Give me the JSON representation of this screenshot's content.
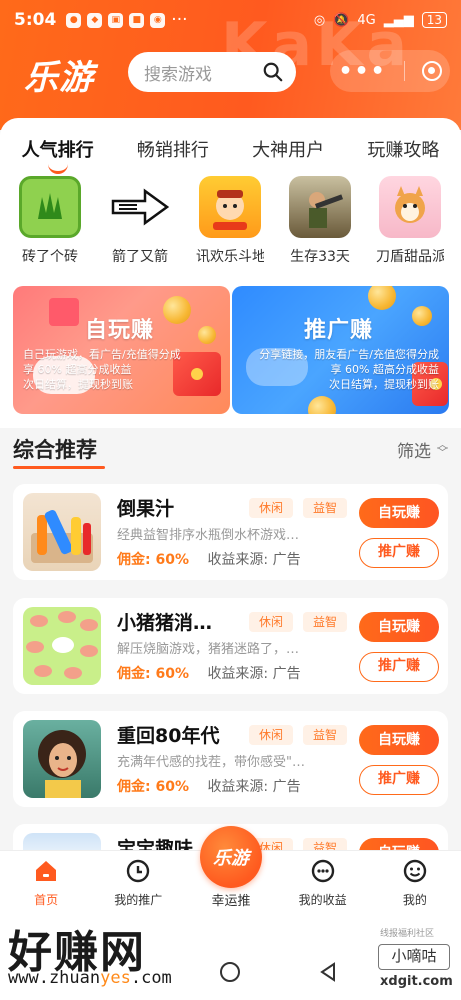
{
  "status_bar": {
    "time": "5:04",
    "more": "···",
    "battery": "13",
    "network": "4G"
  },
  "header": {
    "logo": "乐游",
    "search_placeholder": "搜索游戏",
    "watermark": "KaKa"
  },
  "tabs": [
    {
      "label": "人气排行",
      "active": true
    },
    {
      "label": "畅销排行",
      "active": false
    },
    {
      "label": "大神用户",
      "active": false
    },
    {
      "label": "玩赚攻略",
      "active": false
    }
  ],
  "games": [
    {
      "name": "砖了个砖",
      "icon": "grass-tile-icon",
      "bg": "#8fd14f"
    },
    {
      "name": "箭了又箭",
      "icon": "arrow-maze-icon",
      "bg": "#ffffff"
    },
    {
      "name": "讯欢乐斗地主",
      "icon": "landlord-character-icon",
      "bg": "#ffb21a"
    },
    {
      "name": "生存33天",
      "icon": "soldier-icon",
      "bg": "#8a7a5a"
    },
    {
      "name": "刀盾甜品派",
      "icon": "shiba-dog-icon",
      "bg": "#f7c8d0"
    }
  ],
  "banners": {
    "left": {
      "title": "自玩赚",
      "lines": [
        "自己玩游戏，看广告/充值得分成",
        "享 60% 超高分成收益",
        "次日结算，提现秒到账"
      ],
      "color": "#ff8a7a"
    },
    "right": {
      "title": "推广赚",
      "lines": [
        "分享链接，朋友看广告/充值您得分成",
        "享 60% 超高分成收益",
        "次日结算，提现秒到账"
      ],
      "color": "#2f8bff"
    }
  },
  "section": {
    "title": "综合推荐",
    "filter": "筛选"
  },
  "list": [
    {
      "title": "倒果汁",
      "tags": [
        "休闲",
        "益智"
      ],
      "desc": "经典益智排序水瓶倒水杯游戏…",
      "commission": "佣金: 60%",
      "source": "收益来源: 广告",
      "btn_play": "自玩赚",
      "btn_promo": "推广赚",
      "thumb": "bottles-icon"
    },
    {
      "title": "小猪猪消…",
      "tags": [
        "休闲",
        "益智"
      ],
      "desc": "解压烧脑游戏，猪猪迷路了，…",
      "commission": "佣金: 60%",
      "source": "收益来源: 广告",
      "btn_play": "自玩赚",
      "btn_promo": "推广赚",
      "thumb": "pigs-icon"
    },
    {
      "title": "重回80年代",
      "tags": [
        "休闲",
        "益智"
      ],
      "desc": "充满年代感的找茬，带你感受\"…",
      "commission": "佣金: 60%",
      "source": "收益来源: 广告",
      "btn_play": "自玩赚",
      "btn_promo": "推广赚",
      "thumb": "retro-girl-icon"
    },
    {
      "title": "宝宝趣味…",
      "tags": [
        "休闲",
        "益智"
      ],
      "btn_play": "自玩赚",
      "thumb": "kids-icon"
    }
  ],
  "nav": [
    {
      "label": "首页",
      "icon": "home-icon",
      "active": true
    },
    {
      "label": "我的推广",
      "icon": "promotion-icon",
      "active": false
    },
    {
      "label": "幸运推",
      "icon": "lucky-icon",
      "active": false
    },
    {
      "label": "我的收益",
      "icon": "earnings-icon",
      "active": false
    },
    {
      "label": "我的",
      "icon": "profile-icon",
      "active": false
    }
  ],
  "center_button": "乐游",
  "watermarks": {
    "big": "好赚网",
    "url_prefix": "www.zhuan",
    "url_hl": "yes",
    "url_suffix": ".com",
    "small_top": "线报福利社区",
    "small_box": "小嘀咕",
    "small_url": "xdgit.com"
  }
}
